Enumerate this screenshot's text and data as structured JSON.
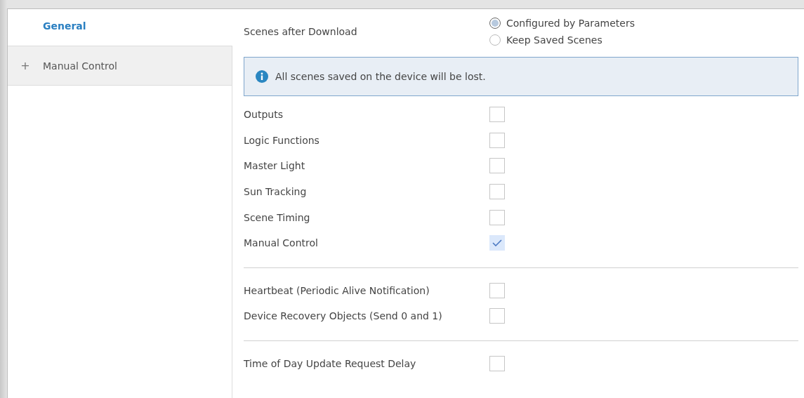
{
  "sidebar": {
    "items": [
      {
        "label": "General",
        "selected": true
      },
      {
        "label": "Manual Control",
        "selected": false,
        "expander": "+"
      }
    ]
  },
  "scenes_after_download": {
    "label": "Scenes after Download",
    "options": [
      {
        "label": "Configured by Parameters",
        "selected": true
      },
      {
        "label": "Keep Saved Scenes",
        "selected": false
      }
    ]
  },
  "info": {
    "text": "All scenes saved on the device will be lost."
  },
  "sections": [
    {
      "rows": [
        {
          "label": "Outputs",
          "checked": false
        },
        {
          "label": "Logic Functions",
          "checked": false
        },
        {
          "label": "Master Light",
          "checked": false
        },
        {
          "label": "Sun Tracking",
          "checked": false
        },
        {
          "label": "Scene Timing",
          "checked": false
        },
        {
          "label": "Manual Control",
          "checked": true
        }
      ]
    },
    {
      "rows": [
        {
          "label": "Heartbeat (Periodic Alive Notification)",
          "checked": false
        },
        {
          "label": "Device Recovery Objects (Send 0 and 1)",
          "checked": false
        }
      ]
    },
    {
      "rows": [
        {
          "label": "Time of Day Update Request Delay",
          "checked": false
        }
      ]
    }
  ]
}
